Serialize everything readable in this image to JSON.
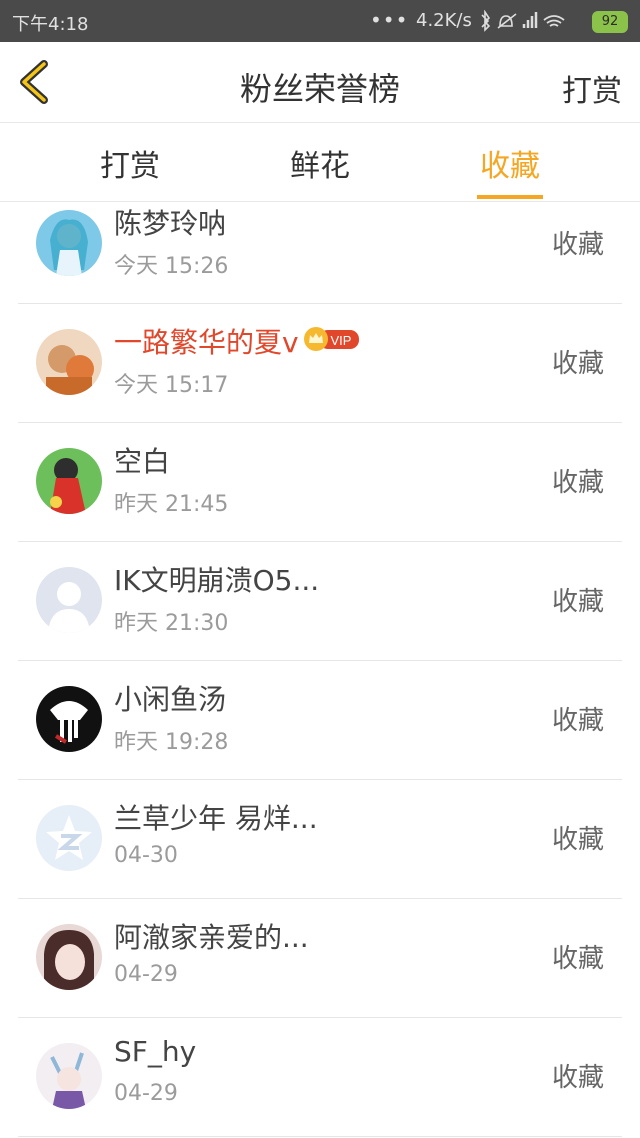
{
  "status_bar": {
    "time": "下午4:18",
    "dots": "•••",
    "speed": "4.2K/s",
    "battery": "92"
  },
  "header": {
    "title": "粉丝荣誉榜",
    "right_label": "打赏"
  },
  "tabs": [
    {
      "label": "打赏"
    },
    {
      "label": "鲜花"
    },
    {
      "label": "收藏"
    }
  ],
  "active_tab": "收藏",
  "accent_color": "#f5a623",
  "vip_name_color": "#e0472b",
  "vip_badge_text": "VIP",
  "fans": [
    {
      "name": "陈梦玲呐",
      "date": "今天 15:26",
      "action": "收藏"
    },
    {
      "name": "一路繁华的夏v",
      "date": "今天 15:17",
      "action": "收藏",
      "vip": true
    },
    {
      "name": "空白",
      "date": "昨天 21:45",
      "action": "收藏"
    },
    {
      "name": "IK文明崩溃O5...",
      "date": "昨天 21:30",
      "action": "收藏"
    },
    {
      "name": "小闲鱼汤",
      "date": "昨天 19:28",
      "action": "收藏"
    },
    {
      "name": "兰草少年 易烊...",
      "date": "04-30",
      "action": "收藏"
    },
    {
      "name": "阿澈家亲爱的...",
      "date": "04-29",
      "action": "收藏"
    },
    {
      "name": "SF_hy",
      "date": "04-29",
      "action": "收藏"
    }
  ]
}
